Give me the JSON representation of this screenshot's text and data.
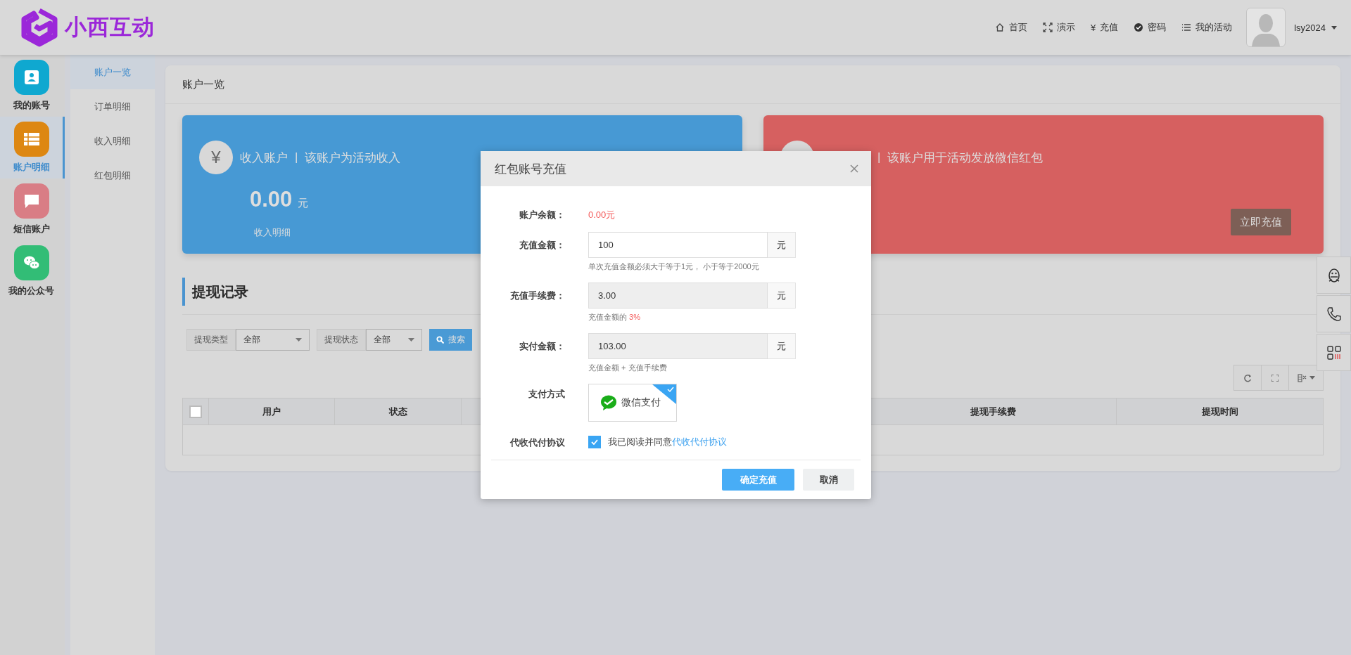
{
  "header": {
    "logo": "小西互动",
    "nav": [
      {
        "label": "首页"
      },
      {
        "label": "演示"
      },
      {
        "glyph": "¥",
        "label": "充值"
      },
      {
        "label": "密码"
      },
      {
        "label": "我的活动"
      }
    ],
    "user": "lsy2024"
  },
  "sidebar": {
    "items": [
      {
        "label": "我的账号",
        "selected": false,
        "color": "#0fa8d0"
      },
      {
        "label": "账户明细",
        "selected": true,
        "color": "#dd8712"
      },
      {
        "label": "短信账户",
        "selected": false,
        "color": "#d97d85"
      },
      {
        "label": "我的公众号",
        "selected": false,
        "color": "#32bd76"
      }
    ]
  },
  "subnav": {
    "items": [
      {
        "label": "账户一览",
        "selected": true
      },
      {
        "label": "订单明细",
        "selected": false
      },
      {
        "label": "收入明细",
        "selected": false
      },
      {
        "label": "红包明细",
        "selected": false
      }
    ]
  },
  "page": {
    "title": "账户一览",
    "accounts": [
      {
        "color": "#4799d4",
        "glyph": "¥",
        "name": "收入账户",
        "separator": "|",
        "description": "该账户为活动收入",
        "amount": "0.00",
        "unit": "元",
        "link": "收入明细"
      },
      {
        "color": "#d66060",
        "separator": "|",
        "description": "该账户用于活动发放微信红包",
        "button": "立即充值"
      }
    ],
    "section_title": "提现记录",
    "filters": [
      {
        "label": "提现类型",
        "value": "全部"
      },
      {
        "label": "提现状态",
        "value": "全部"
      }
    ],
    "search_button": "搜索",
    "table": {
      "select_all": {
        "checked": false
      },
      "columns": [
        "用户",
        "状态",
        "提现手续费",
        "提现时间"
      ]
    }
  },
  "modal": {
    "title": "红包账号充值",
    "fields": [
      {
        "kind": "text",
        "label": "账户余额：",
        "value": "0.00元"
      },
      {
        "kind": "input",
        "label": "充值金额：",
        "value": "100",
        "unit": "元",
        "readonly": false,
        "hint": "单次充值金额必须大于等于1元， 小于等于2000元"
      },
      {
        "kind": "input",
        "label": "充值手续费：",
        "value": "3.00",
        "unit": "元",
        "readonly": true,
        "hint": "充值金额的",
        "hint_highlight": "3%"
      },
      {
        "kind": "input",
        "label": "实付金额：",
        "value": "103.00",
        "unit": "元",
        "readonly": true,
        "hint": "充值金额 + 充值手续费"
      }
    ],
    "payment": {
      "label": "支付方式",
      "options": [
        {
          "label": "微信支付",
          "selected": true
        }
      ]
    },
    "agreement": {
      "label": "代收代付协议",
      "checked": true,
      "text": "我已阅读并同意",
      "link": "代收代付协议"
    },
    "buttons": [
      {
        "label": "确定充值",
        "kind": "primary"
      },
      {
        "label": "取消",
        "kind": "default"
      }
    ]
  }
}
